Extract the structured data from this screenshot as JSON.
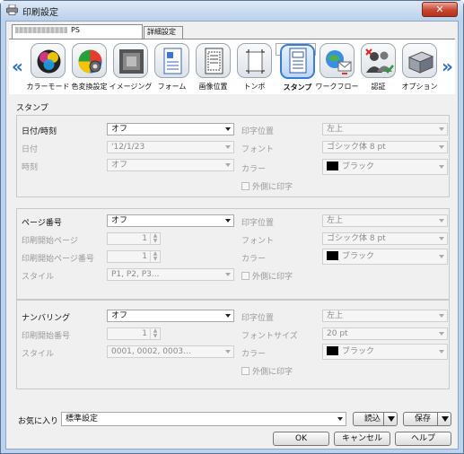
{
  "window": {
    "title": "印刷設定",
    "close": "✕"
  },
  "tabs": {
    "first_suffix": "PS",
    "second": "詳細設定"
  },
  "toolbar": {
    "items": [
      {
        "label": "カラーモード",
        "icon": "color-mode-icon"
      },
      {
        "label": "色変換設定",
        "icon": "color-conversion-icon"
      },
      {
        "label": "イメージング",
        "icon": "imaging-icon"
      },
      {
        "label": "フォーム",
        "icon": "form-icon"
      },
      {
        "label": "画像位置",
        "icon": "image-position-icon"
      },
      {
        "label": "トンボ",
        "icon": "crop-marks-icon"
      },
      {
        "label": "スタンプ",
        "icon": "stamp-icon",
        "selected": true
      },
      {
        "label": "ワークフロー",
        "icon": "workflow-icon"
      },
      {
        "label": "認証",
        "icon": "authentication-icon"
      },
      {
        "label": "オプション",
        "icon": "option-icon"
      }
    ],
    "left_arrow": "«",
    "right_arrow": "»"
  },
  "section_title": "スタンプ",
  "datetime": {
    "label": "日付/時刻",
    "value": "オフ",
    "date_label": "日付",
    "date_value": "'12/1/23",
    "time_label": "時刻",
    "time_value": "オフ",
    "pos_label": "印字位置",
    "pos_value": "左上",
    "font_label": "フォント",
    "font_value": "ゴシック体 8 pt",
    "color_label": "カラー",
    "color_value": "ブラック",
    "outside_label": "外側に印字"
  },
  "page_number": {
    "label": "ページ番号",
    "value": "オフ",
    "start_page_label": "印刷開始ページ",
    "start_page_value": "1",
    "start_num_label": "印刷開始ページ番号",
    "start_num_value": "1",
    "style_label": "スタイル",
    "style_value": "P1, P2, P3...",
    "pos_label": "印字位置",
    "pos_value": "左上",
    "font_label": "フォント",
    "font_value": "ゴシック体 8 pt",
    "color_label": "カラー",
    "color_value": "ブラック",
    "outside_label": "外側に印字"
  },
  "numbering": {
    "label": "ナンバリング",
    "value": "オフ",
    "start_label": "印刷開始番号",
    "start_value": "1",
    "style_label": "スタイル",
    "style_value": "0001, 0002, 0003...",
    "pos_label": "印字位置",
    "pos_value": "左上",
    "size_label": "フォントサイズ",
    "size_value": "20 pt",
    "color_label": "カラー",
    "color_value": "ブラック",
    "outside_label": "外側に印字"
  },
  "favorites": {
    "label": "お気に入り",
    "value": "標準設定",
    "load": "読込",
    "save": "保存"
  },
  "buttons": {
    "ok": "OK",
    "cancel": "キャンセル",
    "help": "ヘルプ"
  }
}
